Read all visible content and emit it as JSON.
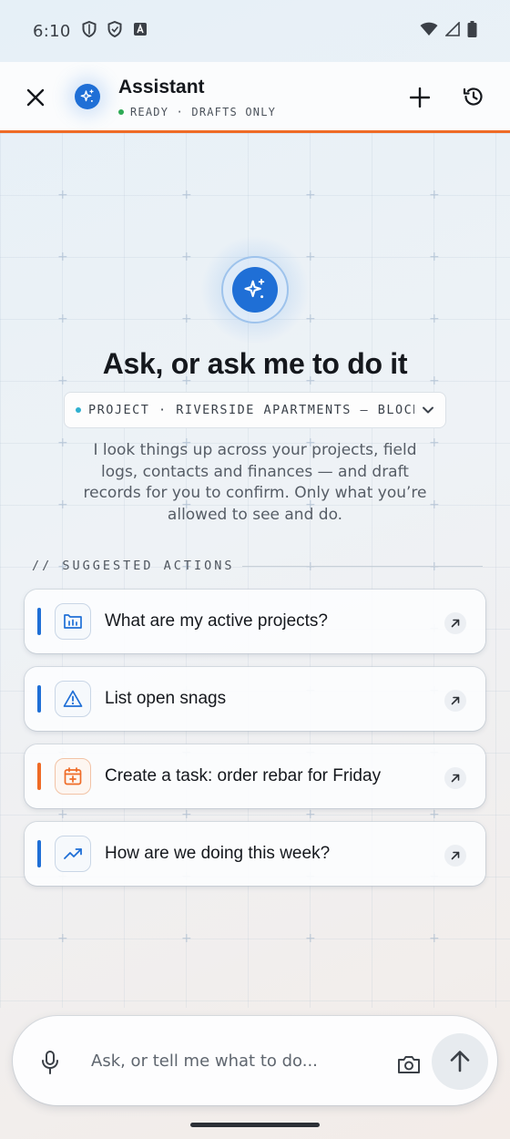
{
  "status_bar": {
    "time": "6:10",
    "icons": [
      "shield-icon",
      "shield-icon",
      "font-icon",
      "wifi-icon",
      "signal-icon",
      "battery-icon"
    ]
  },
  "header": {
    "title": "Assistant",
    "status": "READY · DRAFTS ONLY",
    "status_color": "#2eaa55",
    "accent_color": "#ef6b26",
    "icons": [
      "close-icon",
      "sparkle-icon",
      "plus-icon",
      "history-icon"
    ]
  },
  "hero": {
    "title": "Ask, or ask me to do it",
    "project_selector": "PROJECT · RIVERSIDE APARTMENTS — BLOCK C",
    "description": "I look things up across your projects, field logs, contacts and finances — and draft records for you to confirm. Only what you’re allowed to see and do.",
    "brand_color": "#1f6fd6"
  },
  "suggested": {
    "heading": "// SUGGESTED ACTIONS",
    "items": [
      {
        "label": "What are my active projects?",
        "icon": "project-chart-icon",
        "accent": "#1f6fd6"
      },
      {
        "label": "List open snags",
        "icon": "warning-triangle-icon",
        "accent": "#1f6fd6"
      },
      {
        "label": "Create a task: order rebar for Friday",
        "icon": "calendar-add-icon",
        "accent": "#ef6b26"
      },
      {
        "label": "How are we doing this week?",
        "icon": "trending-up-icon",
        "accent": "#1f6fd6"
      }
    ]
  },
  "composer": {
    "placeholder": "Ask, or tell me what to do...",
    "icons": [
      "mic-icon",
      "camera-icon",
      "send-arrow-icon"
    ]
  }
}
